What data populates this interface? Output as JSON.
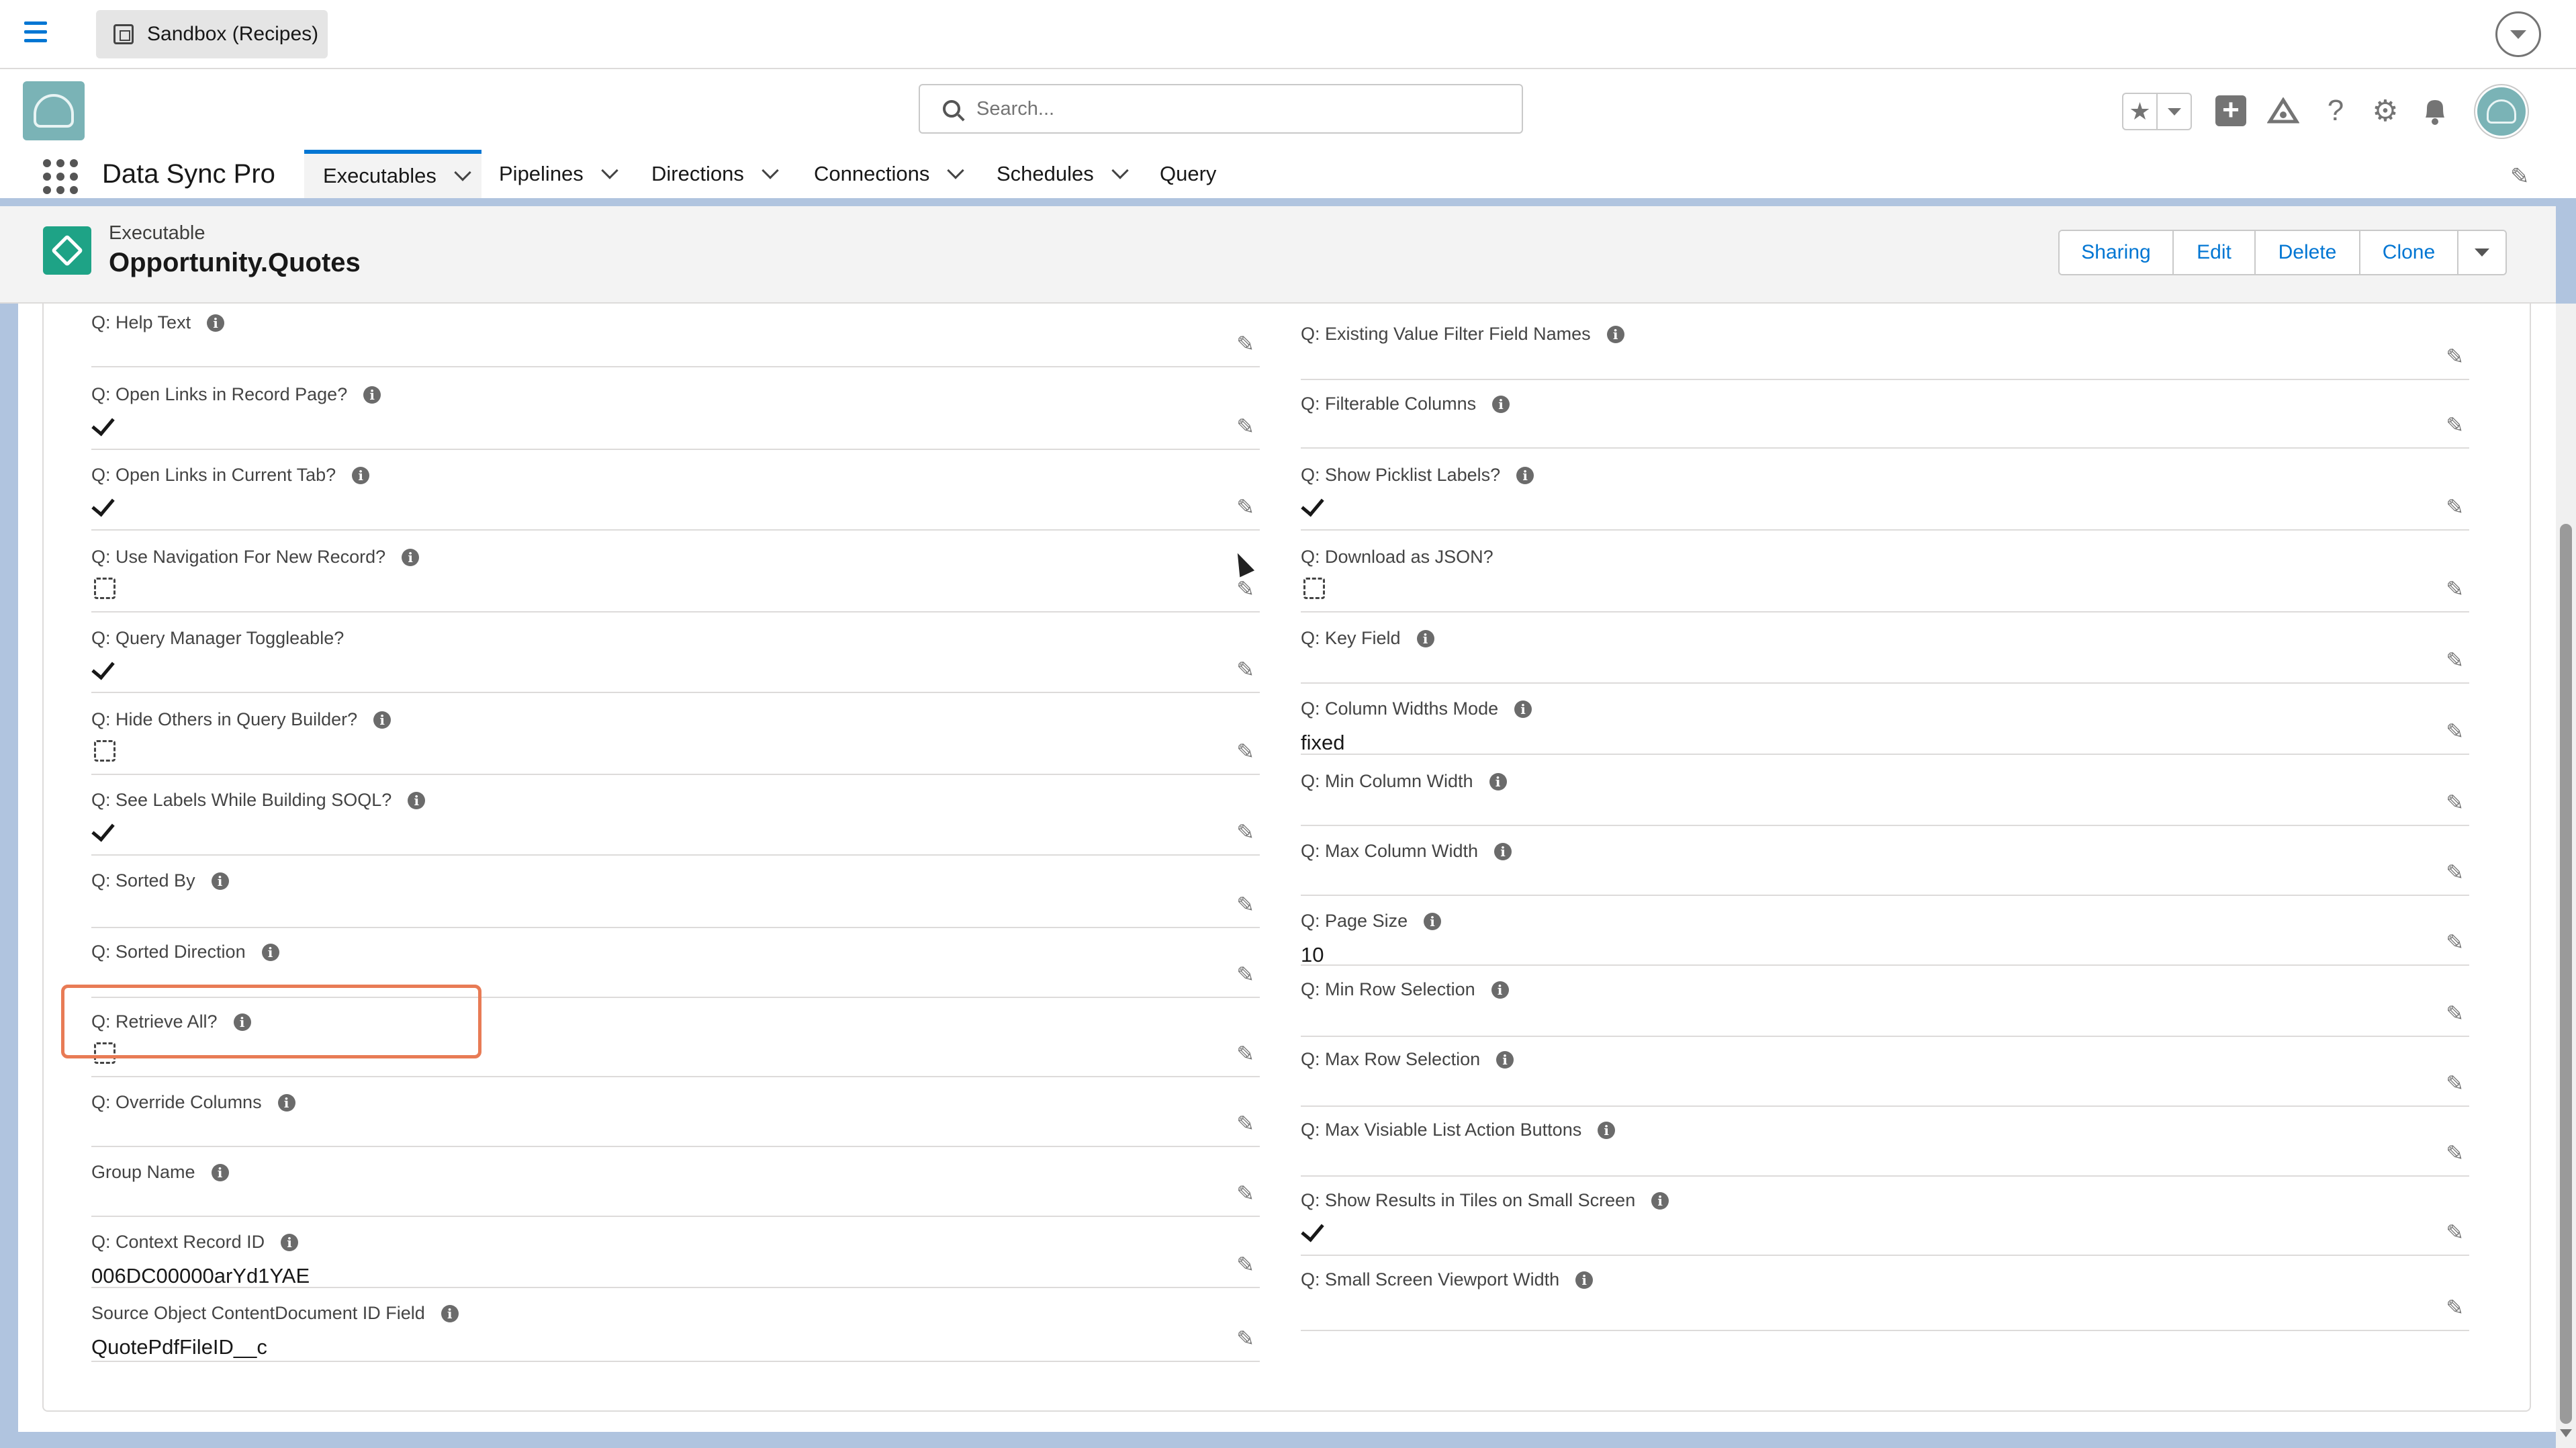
{
  "sandbox": {
    "label": "Sandbox (Recipes)"
  },
  "search": {
    "placeholder": "Search..."
  },
  "app": {
    "name": "Data Sync Pro",
    "tabs": [
      {
        "label": "Executables",
        "active": true,
        "has_menu": true
      },
      {
        "label": "Pipelines",
        "has_menu": true
      },
      {
        "label": "Directions",
        "has_menu": true
      },
      {
        "label": "Connections",
        "has_menu": true
      },
      {
        "label": "Schedules",
        "has_menu": true
      },
      {
        "label": "Query",
        "has_menu": false
      }
    ]
  },
  "record": {
    "type": "Executable",
    "name": "Opportunity.Quotes",
    "actions": [
      "Sharing",
      "Edit",
      "Delete",
      "Clone"
    ]
  },
  "left_fields": [
    {
      "label": "Q: Help Text",
      "info": true,
      "kind": "text",
      "value": ""
    },
    {
      "label": "Q: Open Links in Record Page?",
      "info": true,
      "kind": "checkbox",
      "checked": true
    },
    {
      "label": "Q: Open Links in Current Tab?",
      "info": true,
      "kind": "checkbox",
      "checked": true
    },
    {
      "label": "Q: Use Navigation For New Record?",
      "info": true,
      "kind": "checkbox",
      "checked": false
    },
    {
      "label": "Q: Query Manager Toggleable?",
      "info": false,
      "kind": "checkbox",
      "checked": true
    },
    {
      "label": "Q: Hide Others in Query Builder?",
      "info": true,
      "kind": "checkbox",
      "checked": false
    },
    {
      "label": "Q: See Labels While Building SOQL?",
      "info": true,
      "kind": "checkbox",
      "checked": true
    },
    {
      "label": "Q: Sorted By",
      "info": true,
      "kind": "text",
      "value": ""
    },
    {
      "label": "Q: Sorted Direction",
      "info": true,
      "kind": "text",
      "value": ""
    },
    {
      "label": "Q: Retrieve All?",
      "info": true,
      "kind": "checkbox",
      "checked": false
    },
    {
      "label": "Q: Override Columns",
      "info": true,
      "kind": "text",
      "value": ""
    },
    {
      "label": "Group Name",
      "info": true,
      "kind": "text",
      "value": ""
    },
    {
      "label": "Q: Context Record ID",
      "info": true,
      "kind": "text",
      "value": "006DC00000arYd1YAE"
    },
    {
      "label": "Source Object ContentDocument ID Field",
      "info": true,
      "kind": "text",
      "value": "QuotePdfFileID__c",
      "highlighted": true
    }
  ],
  "right_fields": [
    {
      "label": "Q: Existing Value Filter Field Names",
      "info": true,
      "kind": "text",
      "value": ""
    },
    {
      "label": "Q: Filterable Columns",
      "info": true,
      "kind": "text",
      "value": ""
    },
    {
      "label": "Q: Show Picklist Labels?",
      "info": true,
      "kind": "checkbox",
      "checked": true
    },
    {
      "label": "Q: Download as JSON?",
      "info": false,
      "kind": "checkbox",
      "checked": false
    },
    {
      "label": "Q: Key Field",
      "info": true,
      "kind": "text",
      "value": ""
    },
    {
      "label": "Q: Column Widths Mode",
      "info": true,
      "kind": "text",
      "value": "fixed"
    },
    {
      "label": "Q: Min Column Width",
      "info": true,
      "kind": "text",
      "value": ""
    },
    {
      "label": "Q: Max Column Width",
      "info": true,
      "kind": "text",
      "value": ""
    },
    {
      "label": "Q: Page Size",
      "info": true,
      "kind": "text",
      "value": "10"
    },
    {
      "label": "Q: Min Row Selection",
      "info": true,
      "kind": "text",
      "value": ""
    },
    {
      "label": "Q: Max Row Selection",
      "info": true,
      "kind": "text",
      "value": ""
    },
    {
      "label": "Q: Max Visiable List Action Buttons",
      "info": true,
      "kind": "text",
      "value": ""
    },
    {
      "label": "Q: Show Results in Tiles on Small Screen",
      "info": true,
      "kind": "checkbox",
      "checked": true
    },
    {
      "label": "Q: Small Screen Viewport Width",
      "info": true,
      "kind": "text",
      "value": ""
    }
  ],
  "colors": {
    "brand": "#0176d3",
    "highlight": "#e87b55",
    "record_icon": "#1ea386"
  }
}
